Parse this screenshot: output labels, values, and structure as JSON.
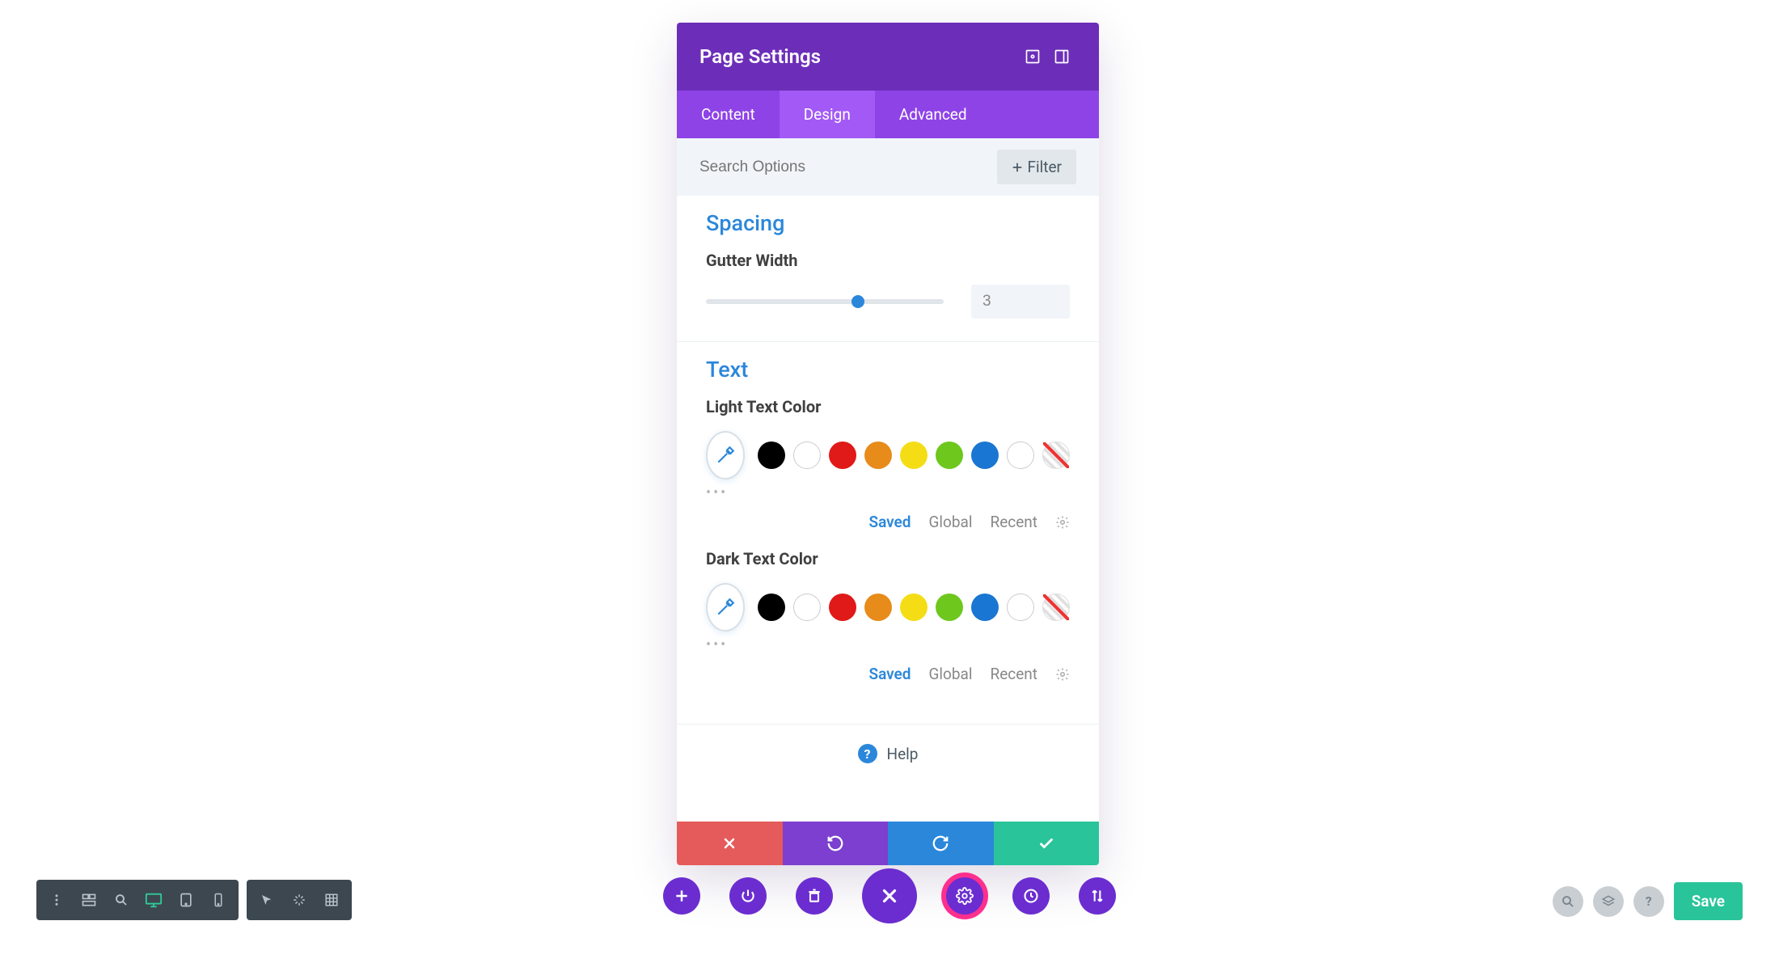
{
  "modal": {
    "title": "Page Settings",
    "tabs": {
      "content": "Content",
      "design": "Design",
      "advanced": "Advanced",
      "active": "design"
    },
    "search_placeholder": "Search Options",
    "filter_label": "Filter"
  },
  "spacing": {
    "heading": "Spacing",
    "gutter_label": "Gutter Width",
    "gutter_value": "3",
    "gutter_pct": 64
  },
  "text": {
    "heading": "Text",
    "light_label": "Light Text Color",
    "dark_label": "Dark Text Color",
    "palette_tabs": {
      "saved": "Saved",
      "global": "Global",
      "recent": "Recent",
      "active": "saved"
    },
    "swatch_colors": [
      "#000000",
      "#ffffff",
      "#e01919",
      "#e78b1a",
      "#f5dd16",
      "#6ec71d",
      "#1976d2",
      "#ffffff"
    ]
  },
  "help_label": "Help",
  "bottom_right": {
    "save": "Save"
  }
}
